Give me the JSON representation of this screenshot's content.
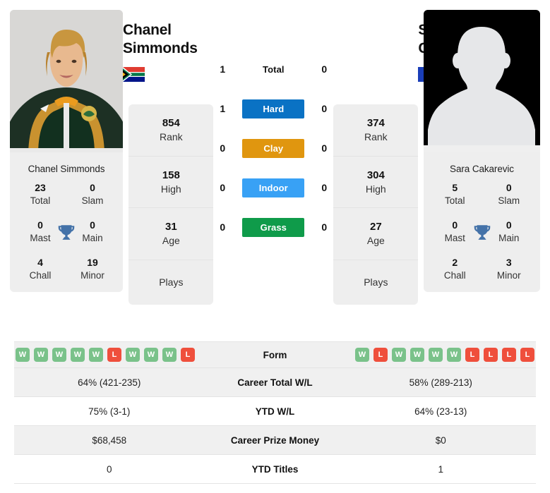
{
  "players": {
    "left": {
      "first_name": "Chanel",
      "last_name": "Simmonds",
      "full_name": "Chanel Simmonds",
      "country": "South Africa",
      "flag_icon": "flag-south-africa",
      "photo_type": "player-photo",
      "titles": {
        "total_value": "23",
        "total_label": "Total",
        "slam_value": "0",
        "slam_label": "Slam",
        "mast_value": "0",
        "mast_label": "Mast",
        "main_value": "0",
        "main_label": "Main",
        "chall_value": "4",
        "chall_label": "Chall",
        "minor_value": "19",
        "minor_label": "Minor"
      },
      "rank_value": "854",
      "rank_label": "Rank",
      "high_value": "158",
      "high_label": "High",
      "age_value": "31",
      "age_label": "Age",
      "plays_label": "Plays",
      "plays_value": "",
      "h2h": {
        "total": "1",
        "hard": "1",
        "clay": "0",
        "indoor": "0",
        "grass": "0"
      },
      "form": [
        "W",
        "W",
        "W",
        "W",
        "W",
        "L",
        "W",
        "W",
        "W",
        "L"
      ],
      "career_total_wl": "64% (421-235)",
      "ytd_wl": "75% (3-1)",
      "career_prize_money": "$68,458",
      "ytd_titles": "0"
    },
    "right": {
      "first_name": "Sara",
      "last_name": "Cakarevic",
      "full_name": "Sara Cakarevic",
      "country": "France",
      "flag_icon": "flag-france",
      "photo_type": "silhouette-placeholder",
      "titles": {
        "total_value": "5",
        "total_label": "Total",
        "slam_value": "0",
        "slam_label": "Slam",
        "mast_value": "0",
        "mast_label": "Mast",
        "main_value": "0",
        "main_label": "Main",
        "chall_value": "2",
        "chall_label": "Chall",
        "minor_value": "3",
        "minor_label": "Minor"
      },
      "rank_value": "374",
      "rank_label": "Rank",
      "high_value": "304",
      "high_label": "High",
      "age_value": "27",
      "age_label": "Age",
      "plays_label": "Plays",
      "plays_value": "",
      "h2h": {
        "total": "0",
        "hard": "0",
        "clay": "0",
        "indoor": "0",
        "grass": "0"
      },
      "form": [
        "W",
        "L",
        "W",
        "W",
        "W",
        "W",
        "L",
        "L",
        "L",
        "L"
      ],
      "career_total_wl": "58% (289-213)",
      "ytd_wl": "64% (23-13)",
      "career_prize_money": "$0",
      "ytd_titles": "1"
    }
  },
  "surfaces": [
    {
      "key": "total",
      "label": "Total",
      "color": "transparent",
      "text_color": "#111111"
    },
    {
      "key": "hard",
      "label": "Hard",
      "color": "#0a72c4",
      "text_color": "#ffffff"
    },
    {
      "key": "clay",
      "label": "Clay",
      "color": "#e0960f",
      "text_color": "#ffffff"
    },
    {
      "key": "indoor",
      "label": "Indoor",
      "color": "#38a1f5",
      "text_color": "#ffffff"
    },
    {
      "key": "grass",
      "label": "Grass",
      "color": "#0f9b4a",
      "text_color": "#ffffff"
    }
  ],
  "form_section": {
    "label": "Form"
  },
  "stat_rows": [
    {
      "label": "Career Total W/L",
      "left": "64% (421-235)",
      "right": "58% (289-213)"
    },
    {
      "label": "YTD W/L",
      "left": "75% (3-1)",
      "right": "64% (23-13)"
    },
    {
      "label": "Career Prize Money",
      "left": "$68,458",
      "right": "$0"
    },
    {
      "label": "YTD Titles",
      "left": "0",
      "right": "1"
    }
  ],
  "colors": {
    "card_bg": "#eeeeee",
    "row_alt_bg": "#f0f0f0",
    "win_badge": "#7ac28a",
    "loss_badge": "#ef4f3c",
    "trophy": "#4472a8",
    "hard": "#0a72c4",
    "clay": "#e0960f",
    "indoor": "#38a1f5",
    "grass": "#0f9b4a"
  }
}
